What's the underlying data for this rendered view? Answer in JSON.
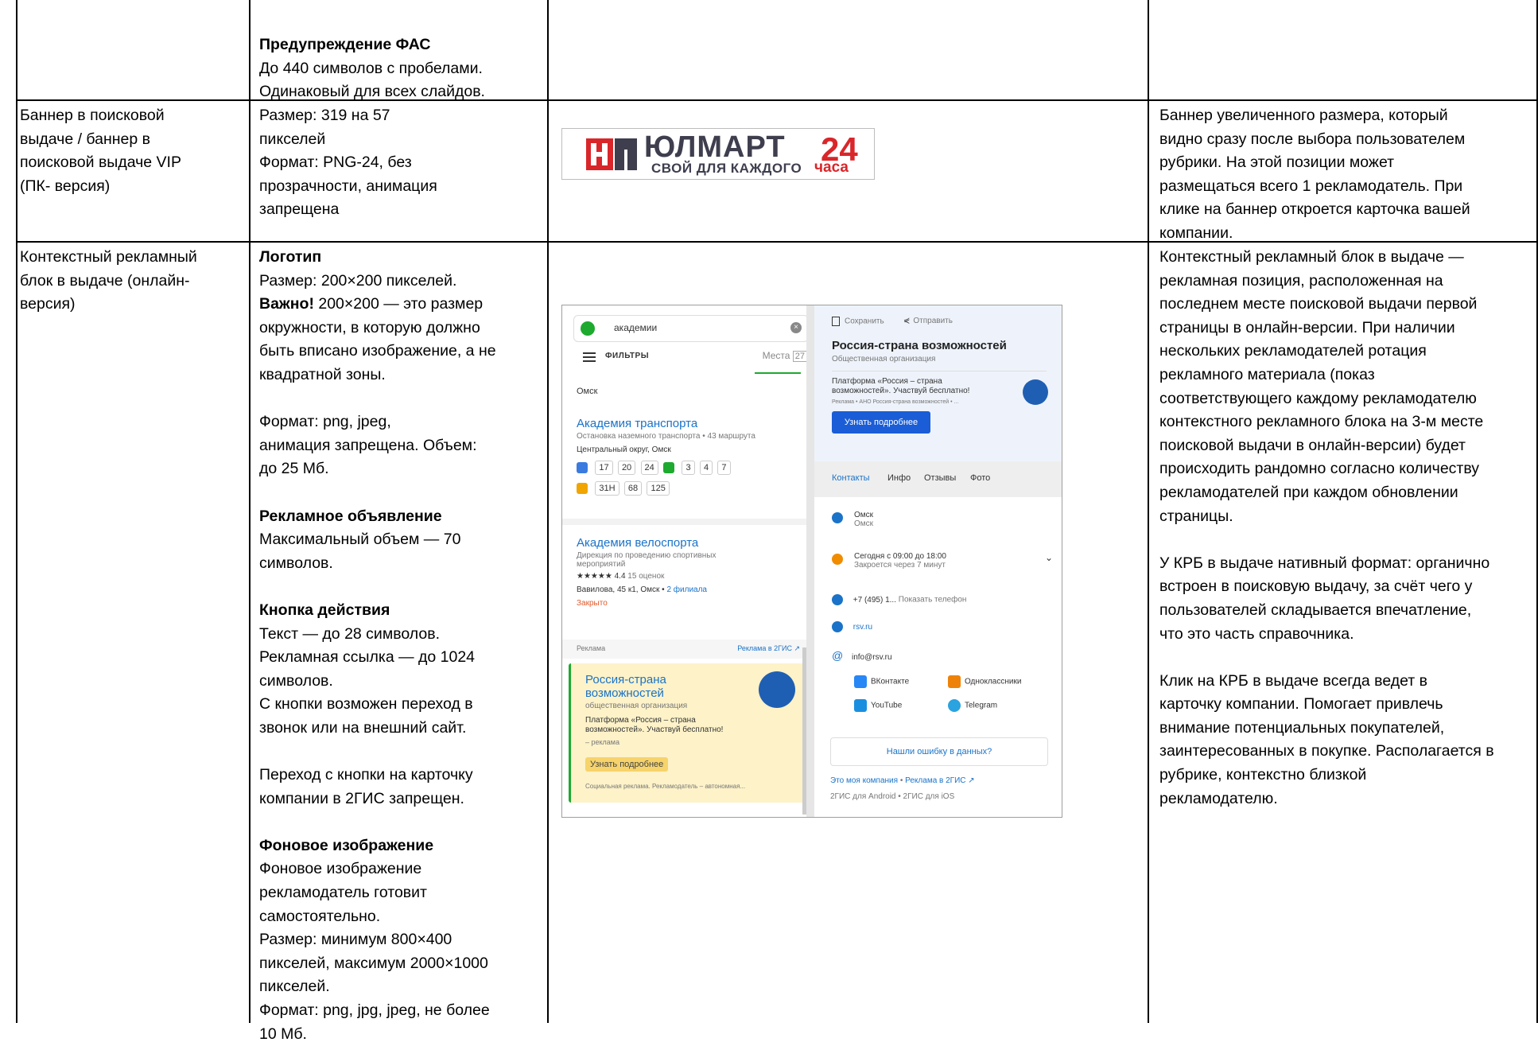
{
  "row0": {
    "c2_heading": "Предупреждение ФАС",
    "c2_lines": [
      "До 440 символов с пробелами.",
      "Одинаковый для всех слайдов."
    ]
  },
  "row1": {
    "c1_lines": [
      "Баннер в поисковой",
      "выдаче / баннер в",
      "поисковой выдаче VIP",
      "(ПК- версия)"
    ],
    "c2_lines": [
      "Размер: 319 на 57",
      "пикселей",
      "Формат: PNG-24, без",
      "прозрачности, анимация",
      "запрещена"
    ],
    "banner": {
      "brand": "ЮЛМАРТ",
      "number": "24",
      "tagline": "СВОЙ ДЛЯ КАЖДОГО",
      "tagline_suffix": "часа",
      "accent": "#d9262a"
    },
    "c4_lines": [
      "Баннер увеличенного размера, который",
      "видно сразу после выбора пользователем",
      "рубрики. На этой позиции может",
      "размещаться всего 1 рекламодатель. При",
      "клике на баннер откроется карточка вашей",
      "компании."
    ]
  },
  "row2": {
    "c1_lines": [
      "Контекстный рекламный",
      "блок в выдаче (онлайн-",
      "версия)"
    ],
    "c2": {
      "logo_heading": "Логотип",
      "logo_size": "Размер: 200×200 пикселей.",
      "important_bold": "Важно!",
      "important_rest": " 200×200 — это размер",
      "important_lines": [
        "окружности, в которую должно",
        "быть вписано изображение, а не",
        "квадратной зоны."
      ],
      "format_lines": [
        "Формат: png, jpeg,",
        "анимация запрещена. Объем:",
        "до 25 Мб."
      ],
      "ad_heading": "Рекламное объявление",
      "ad_lines": [
        "Максимальный объем — 70",
        "символов."
      ],
      "cta_heading": "Кнопка действия",
      "cta_lines": [
        "Текст — до 28 символов.",
        "Рекламная ссылка — до 1024",
        "символов.",
        "С кнопки возможен переход в",
        "звонок или на внешний сайт."
      ],
      "note_lines": [
        "Переход с кнопки на карточку",
        "компании в 2ГИС запрещен."
      ],
      "bg_heading": "Фоновое изображение",
      "bg_lines": [
        "Фоновое изображение",
        "рекламодатель готовит",
        "самостоятельно.",
        "Размер: минимум 800×400",
        "пикселей, максимум 2000×1000",
        "пикселей.",
        "Формат: png, jpg, jpeg, не более",
        "10 Мб."
      ]
    },
    "c4_p1": [
      "Контекстный рекламный блок в выдаче —",
      "рекламная позиция, расположенная на",
      "последнем месте поисковой выдачи первой",
      "страницы в онлайн-версии. При наличии",
      "нескольких рекламодателей ротация",
      "рекламного материала (показ",
      "соответствующего каждому рекламодателю",
      "контекстного рекламного блока на 3-м месте",
      "поисковой выдачи в онлайн-версии) будет",
      "происходить рандомно согласно количеству",
      "рекламодателей при каждом обновлении",
      "страницы."
    ],
    "c4_p2": [
      "У КРБ в выдаче нативный формат: органично",
      "встроен в поисковую выдачу, за счёт чего у",
      "пользователей складывается впечатление,",
      "что это часть справочника."
    ],
    "c4_p3": [
      "Клик на КРБ в выдаче всегда ведет в",
      "карточку компании. Помогает привлечь",
      "внимание потенциальных покупателей,",
      "заинтересованных в покупке. Располагается в",
      "рубрике, контекстно близкой",
      "рекламодателю."
    ]
  },
  "mock": {
    "search_value": "академии",
    "filters": "ФИЛЬТРЫ",
    "places_label": "Места",
    "places_count": "27",
    "city_top": "Омск",
    "r1_title": "Академия транспорта",
    "r1_sub": "Остановка наземного транспорта",
    "r1_routes": "43 маршрута",
    "r1_area": "Центральный округ, Омск",
    "r1_bus": [
      "17",
      "20",
      "24"
    ],
    "r1_tram": [
      "3",
      "4",
      "7"
    ],
    "r1_mini": [
      "31Н",
      "68",
      "125"
    ],
    "r2_title": "Академия велоспорта",
    "r2_sub1": "Дирекция по проведению спортивных",
    "r2_sub2": "мероприятий",
    "r2_stars": "★★★★★",
    "r2_rating": "4.4",
    "r2_reviews": "15 оценок",
    "r2_address": "Вавилова, 45 к1, Омск",
    "r2_branches": "2 филиала",
    "r2_status": "Закрыто",
    "ad_label": "Реклама",
    "ad_link": "Реклама в 2ГИС ↗",
    "ad_title1": "Россия-страна",
    "ad_title2": "возможностей",
    "ad_type": "общественная организация",
    "ad_text1": "Платформа «Россия – страна",
    "ad_text2": "возможностей». Участвуй бесплатно!",
    "ad_marker": "– реклама",
    "ad_button": "Узнать подробнее",
    "ad_footer": "Социальная реклама. Рекламодатель – автономная...",
    "save": "Сохранить",
    "send": "Отправить",
    "org_title": "Россия-страна возможностей",
    "org_type": "Общественная организация",
    "org_text1": "Платформа «Россия – страна",
    "org_text2": "возможностей». Участвуй бесплатно!",
    "org_adline": "Реклама • АНО Россия-страна возможностей • ...",
    "org_button": "Узнать подробнее",
    "tabs": [
      "Контакты",
      "Инфо",
      "Отзывы",
      "Фото"
    ],
    "city": "Омск",
    "city_sub": "Омск",
    "hours": "Сегодня с 09:00 до 18:00",
    "hours_sub": "Закроется через 7 минут",
    "phone": "+7 (495) 1...",
    "phone_show": "Показать телефон",
    "site": "rsv.ru",
    "email": "info@rsv.ru",
    "social": [
      "ВКонтакте",
      "Одноклассники",
      "YouTube",
      "Telegram"
    ],
    "error_link": "Нашли ошибку в данных?",
    "own_company": "Это моя компания",
    "ad_2gis": "Реклама в 2ГИС ↗",
    "apps": "2ГИС для Android • 2ГИС для iOS"
  }
}
